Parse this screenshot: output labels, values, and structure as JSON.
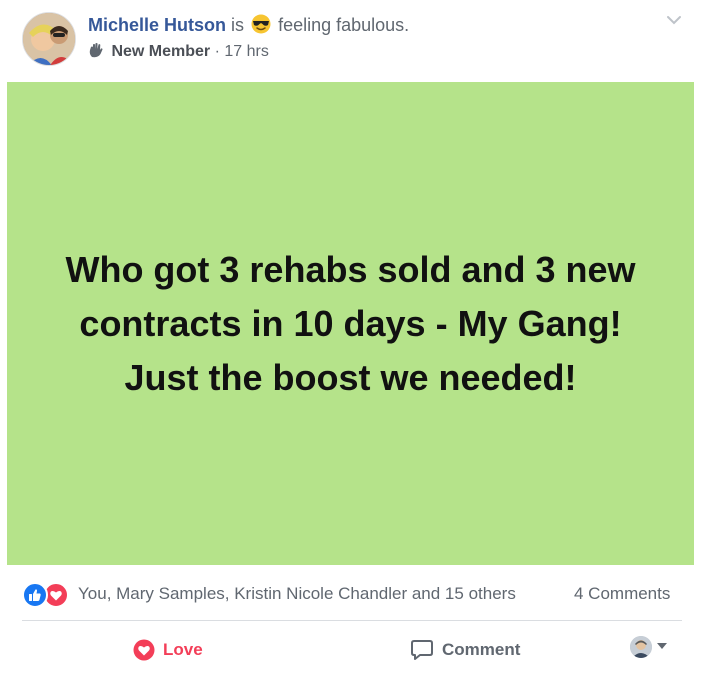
{
  "post": {
    "author": "Michelle Hutson",
    "is_word": "is",
    "feeling_emoji": "😎",
    "feeling_text": "feeling fabulous.",
    "badge": "New Member",
    "separator": "·",
    "time": "17 hrs",
    "status_text": "Who got 3 rehabs sold and 3 new contracts in 10 days - My Gang! Just the boost we needed!",
    "background_color": "#b5e38a"
  },
  "reactions": {
    "icons": [
      "like-icon",
      "love-icon"
    ],
    "summary": "You, Mary Samples, Kristin Nicole Chandler and 15 others",
    "comments": "4 Comments"
  },
  "actions": {
    "love_label": "Love",
    "comment_label": "Comment"
  },
  "colors": {
    "link_blue": "#365899",
    "love_red": "#f33e58",
    "like_blue": "#1877f2"
  }
}
